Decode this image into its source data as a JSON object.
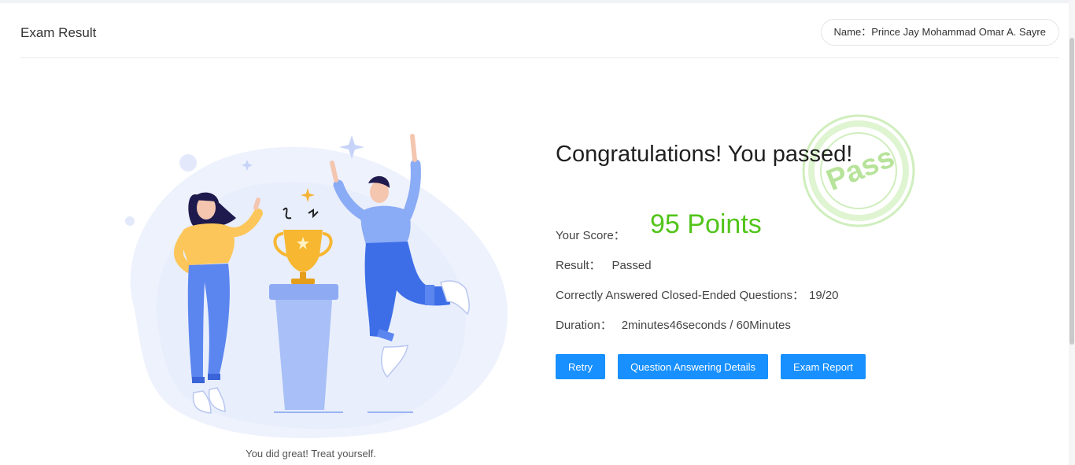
{
  "header": {
    "title": "Exam Result",
    "name_label": "Name：",
    "name_value": "Prince Jay Mohammad Omar A. Sayre"
  },
  "result": {
    "headline": "Congratulations! You passed!",
    "score_label": "Your Score：",
    "score_value": "95 Points",
    "result_label": "Result：",
    "result_value": "Passed",
    "correct_label": "Correctly Answered Closed-Ended Questions：",
    "correct_value": "19/20",
    "duration_label": "Duration：",
    "duration_value": "2minutes46seconds / 60Minutes",
    "stamp_text": "Pass"
  },
  "buttons": {
    "retry": "Retry",
    "details": "Question Answering Details",
    "report": "Exam Report"
  },
  "caption": "You did great! Treat yourself.",
  "colors": {
    "accent": "#1890ff",
    "score": "#52c41a",
    "stamp": "#b7e39a"
  }
}
